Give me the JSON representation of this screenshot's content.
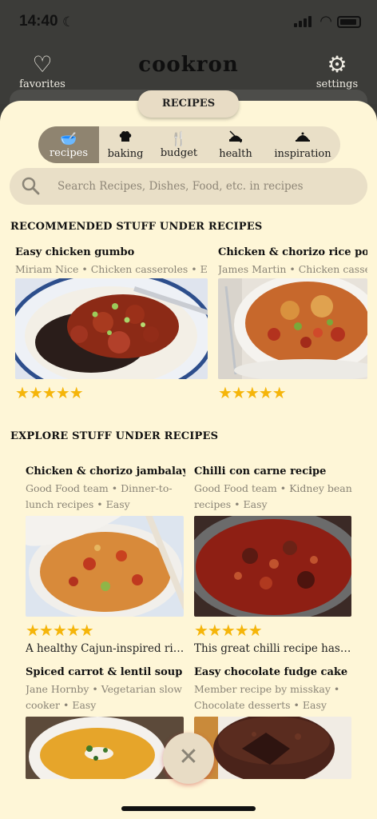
{
  "status_bar": {
    "time": "14:40"
  },
  "header": {
    "brand": "cookron",
    "favorites_label": "favorites",
    "settings_label": "settings"
  },
  "sheet_title": "RECIPES",
  "categories": [
    {
      "label": "recipes",
      "icon": "mixing-bowl-icon",
      "active": true
    },
    {
      "label": "baking",
      "icon": "chef-hat-icon",
      "active": false
    },
    {
      "label": "budget",
      "icon": "cutlery-icon",
      "active": false
    },
    {
      "label": "health",
      "icon": "healthy-food-icon",
      "active": false
    },
    {
      "label": "inspiration",
      "icon": "cloche-icon",
      "active": false
    }
  ],
  "search": {
    "placeholder": "Search Recipes, Dishes, Food, etc. in recipes"
  },
  "recommended": {
    "title": "RECOMMENDED STUFF UNDER RECIPES",
    "items": [
      {
        "title": "Easy chicken gumbo",
        "meta": "Miriam Nice • Chicken casseroles • Easy",
        "rating": 5
      },
      {
        "title": "Chicken & chorizo rice pot",
        "meta": "James Martin • Chicken casseroles",
        "rating": 5
      }
    ]
  },
  "explore": {
    "title": "EXPLORE STUFF UNDER RECIPES",
    "items": [
      {
        "title": "Chicken & chorizo jambalaya",
        "meta": "Good Food team • Dinner-to-lunch recipes • Easy",
        "rating": 5,
        "desc": "A healthy Cajun-inspired rice pot"
      },
      {
        "title": "Chilli con carne recipe",
        "meta": "Good Food team • Kidney bean recipes • Easy",
        "rating": 5,
        "desc": "This great chilli recipe has to be"
      },
      {
        "title": "Spiced carrot & lentil soup",
        "meta": "Jane Hornby • Vegetarian slow cooker • Easy",
        "rating": 5,
        "desc": ""
      },
      {
        "title": "Easy chocolate fudge cake",
        "meta": "Member recipe by misskay • Chocolate desserts • Easy",
        "rating": 5,
        "desc": ""
      }
    ]
  },
  "close_button": {
    "icon": "close-icon",
    "glyph": "✕"
  },
  "colors": {
    "sheet_bg": "#fef6d7",
    "pill_bg": "#e9dfc7",
    "active_pill": "#8f8470",
    "star": "#f5b50a",
    "meta_text": "#8a8476"
  }
}
